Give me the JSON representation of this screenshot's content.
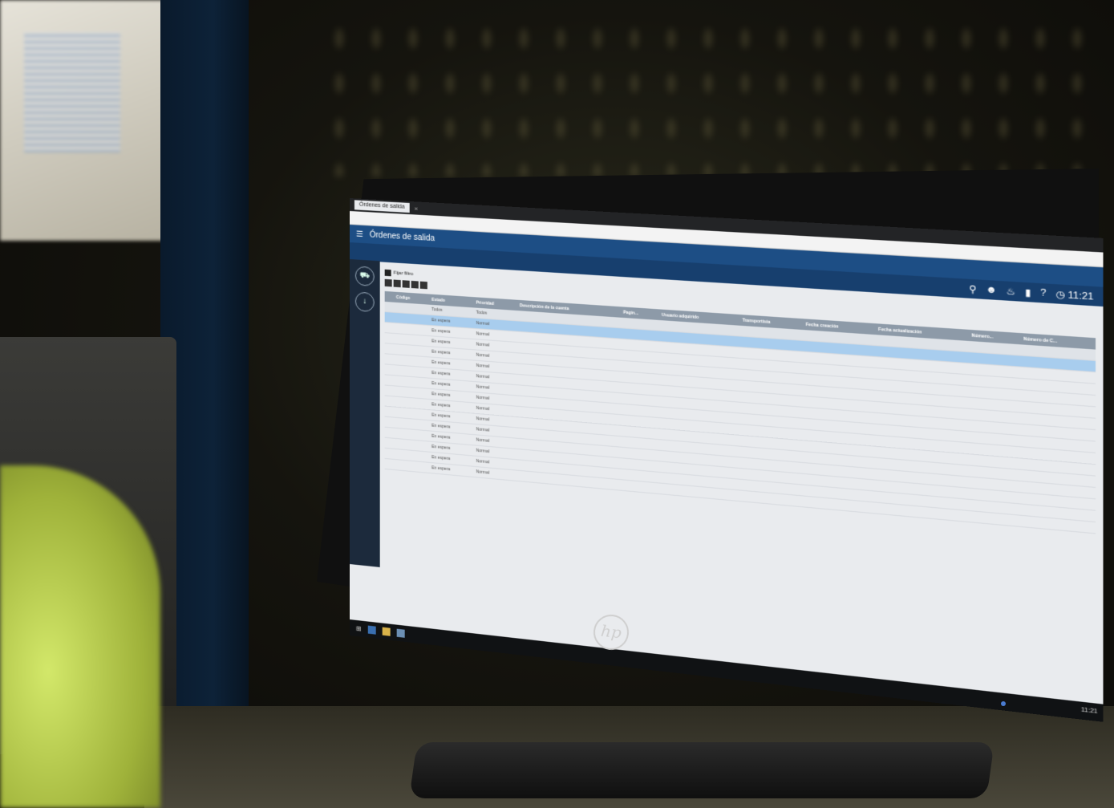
{
  "browser": {
    "tabs": [
      {
        "label": "Órdenes de salida",
        "active": true
      }
    ],
    "close_label": "×"
  },
  "app": {
    "title": "Órdenes de salida",
    "menu_icon": "hamburger-icon",
    "header_icons": [
      "search-icon",
      "user-icon",
      "bell-icon",
      "chart-icon",
      "help-icon"
    ],
    "clock": "11:21",
    "help_label": "?"
  },
  "leftnav": {
    "items": [
      {
        "icon": "truck-icon"
      },
      {
        "icon": "download-icon"
      }
    ]
  },
  "list": {
    "filter_label": "Fijar filtro",
    "columns": [
      "Código",
      "Estado",
      "Prioridad",
      "Descripción de la cuenta",
      "Pagin...",
      "Usuario adquirido",
      "Transportista",
      "Fecha creación",
      "Fecha actualización",
      "Número...",
      "Número de C..."
    ],
    "estado_filter": "Todos",
    "prioridad_filter": "Todos",
    "rows": [
      {
        "estado": "En espera",
        "prioridad": "Normal",
        "highlight": true
      },
      {
        "estado": "En espera",
        "prioridad": "Normal"
      },
      {
        "estado": "En espera",
        "prioridad": "Normal"
      },
      {
        "estado": "En espera",
        "prioridad": "Normal"
      },
      {
        "estado": "En espera",
        "prioridad": "Normal"
      },
      {
        "estado": "En espera",
        "prioridad": "Normal"
      },
      {
        "estado": "En espera",
        "prioridad": "Normal"
      },
      {
        "estado": "En espera",
        "prioridad": "Normal"
      },
      {
        "estado": "En espera",
        "prioridad": "Normal"
      },
      {
        "estado": "En espera",
        "prioridad": "Normal"
      },
      {
        "estado": "En espera",
        "prioridad": "Normal"
      },
      {
        "estado": "En espera",
        "prioridad": "Normal"
      },
      {
        "estado": "En espera",
        "prioridad": "Normal"
      },
      {
        "estado": "En espera",
        "prioridad": "Normal"
      },
      {
        "estado": "En espera",
        "prioridad": "Normal"
      }
    ]
  },
  "monitor": {
    "brand": "hp"
  },
  "taskbar": {
    "clock_time": "11:21"
  }
}
